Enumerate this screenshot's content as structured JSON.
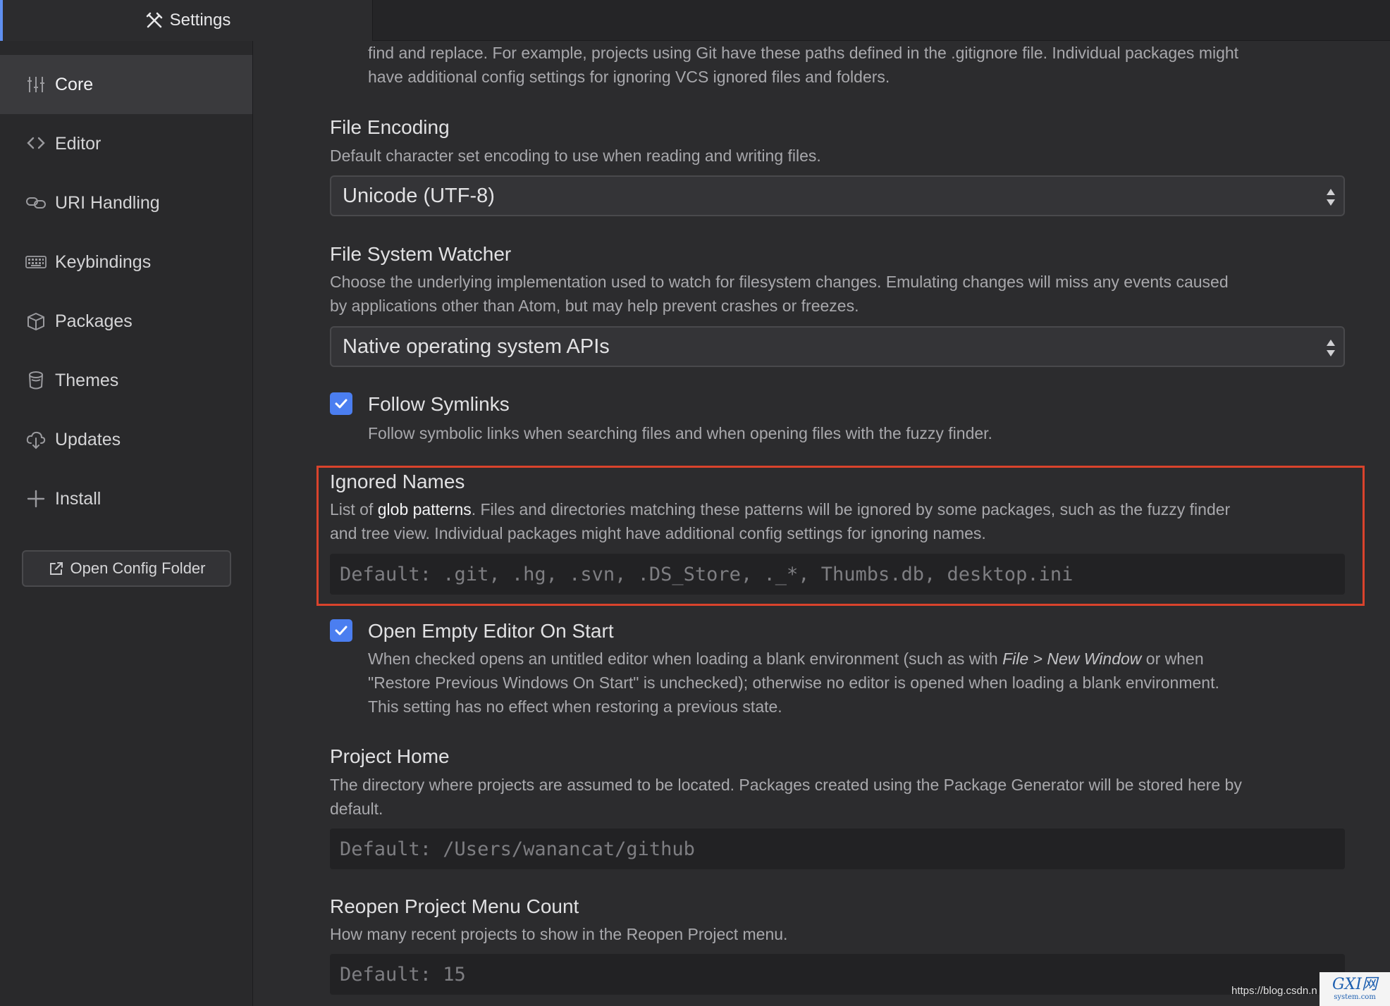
{
  "tab": {
    "label": "Settings",
    "icon": "tools-icon"
  },
  "sidebar": {
    "items": [
      {
        "label": "Core",
        "icon": "sliders-icon",
        "active": true
      },
      {
        "label": "Editor",
        "icon": "code-icon",
        "active": false
      },
      {
        "label": "URI Handling",
        "icon": "link-icon",
        "active": false
      },
      {
        "label": "Keybindings",
        "icon": "keyboard-icon",
        "active": false
      },
      {
        "label": "Packages",
        "icon": "package-icon",
        "active": false
      },
      {
        "label": "Themes",
        "icon": "paintcan-icon",
        "active": false
      },
      {
        "label": "Updates",
        "icon": "cloud-download-icon",
        "active": false
      },
      {
        "label": "Install",
        "icon": "plus-icon",
        "active": false
      }
    ],
    "open_config_label": "Open Config Folder"
  },
  "settings": {
    "vcs_desc_line1": "find and replace. For example, projects using Git have these paths defined in the .gitignore file. Individual packages might",
    "vcs_desc_line2": "have additional config settings for ignoring VCS ignored files and folders.",
    "file_encoding": {
      "title": "File Encoding",
      "desc": "Default character set encoding to use when reading and writing files.",
      "value": "Unicode (UTF-8)"
    },
    "fs_watcher": {
      "title": "File System Watcher",
      "desc_line1": "Choose the underlying implementation used to watch for filesystem changes. Emulating changes will miss any events caused",
      "desc_line2": "by applications other than Atom, but may help prevent crashes or freezes.",
      "value": "Native operating system APIs"
    },
    "follow_symlinks": {
      "title": "Follow Symlinks",
      "desc": "Follow symbolic links when searching files and when opening files with the fuzzy finder.",
      "checked": true
    },
    "ignored_names": {
      "title": "Ignored Names",
      "desc_prefix": "List of ",
      "desc_link": "glob patterns",
      "desc_suffix": ". Files and directories matching these patterns will be ignored by some packages, such as the fuzzy finder",
      "desc_line2": "and tree view. Individual packages might have additional config settings for ignoring names.",
      "placeholder": "Default: .git, .hg, .svn, .DS_Store, ._*, Thumbs.db, desktop.ini"
    },
    "open_empty_editor": {
      "title": "Open Empty Editor On Start",
      "desc_line1_prefix": "When checked opens an untitled editor when loading a blank environment (such as with ",
      "desc_line1_em": "File > New Window",
      "desc_line1_suffix": " or when",
      "desc_line2": "\"Restore Previous Windows On Start\" is unchecked); otherwise no editor is opened when loading a blank environment.",
      "desc_line3": "This setting has no effect when restoring a previous state.",
      "checked": true
    },
    "project_home": {
      "title": "Project Home",
      "desc_line1": "The directory where projects are assumed to be located. Packages created using the Package Generator will be stored here by",
      "desc_line2": "default.",
      "placeholder": "Default: /Users/wanancat/github"
    },
    "reopen_count": {
      "title": "Reopen Project Menu Count",
      "desc": "How many recent projects to show in the Reopen Project menu.",
      "placeholder": "Default: 15"
    }
  },
  "watermark": {
    "url": "https://blog.csdn.n",
    "logo_main": "GXI网",
    "logo_sub": "system.com"
  },
  "colors": {
    "accent": "#4b7ef0",
    "highlight_border": "#d9432c",
    "background": "#2c2c2e"
  }
}
